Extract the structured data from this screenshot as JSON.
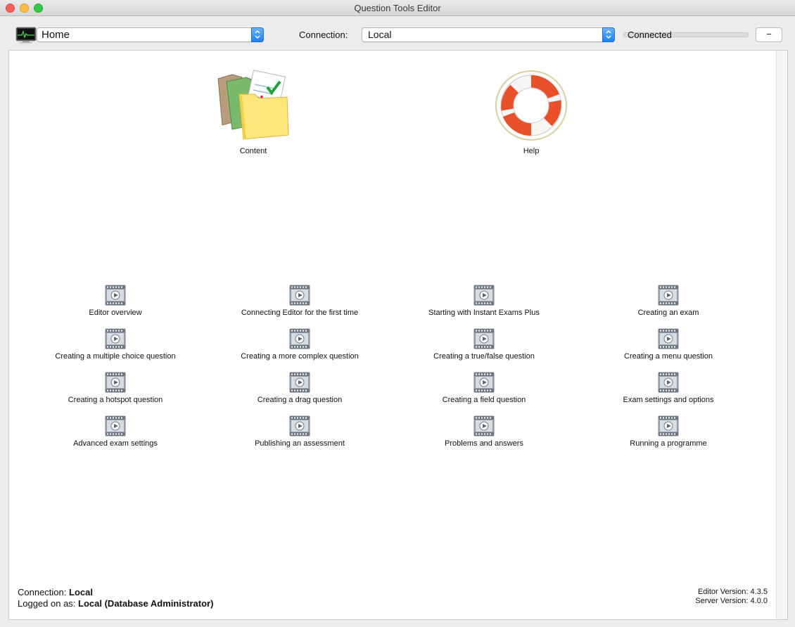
{
  "window": {
    "title": "Question Tools Editor"
  },
  "toolbar": {
    "page_select_value": "Home",
    "connection_label": "Connection:",
    "connection_select_value": "Local",
    "connection_status": "Connected",
    "minus_label": "−"
  },
  "tiles": [
    {
      "label": "Content",
      "icon": "folders-icon"
    },
    {
      "label": "Help",
      "icon": "lifebuoy-icon"
    }
  ],
  "videos": [
    "Editor overview",
    "Connecting Editor for the first time",
    "Starting with Instant Exams Plus",
    "Creating an exam",
    "Creating a multiple choice question",
    "Creating a more complex question",
    "Creating a true/false question",
    "Creating a menu question",
    "Creating a hotspot question",
    "Creating a drag question",
    "Creating a field question",
    "Exam settings and options",
    "Advanced exam settings",
    "Publishing an assessment",
    "Problems and answers",
    "Running a programme"
  ],
  "footer": {
    "connection_prefix": "Connection: ",
    "connection_value": "Local",
    "logged_prefix": "Logged on as: ",
    "logged_value": "Local (Database Administrator)",
    "editor_version": "Editor Version: 4.3.5",
    "server_version": "Server Version: 4.0.0"
  },
  "colors": {
    "accent": "#1a82f7",
    "lifebuoy": "#e8502a"
  }
}
